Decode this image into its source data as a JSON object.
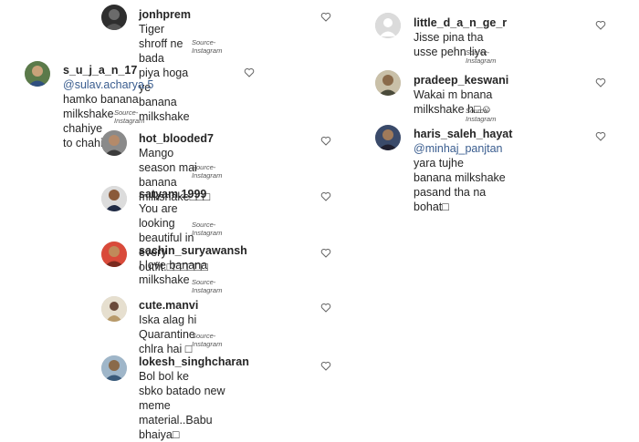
{
  "source_label": "Source-Instagram",
  "left_column": [
    {
      "username": "jonhprem",
      "mention": "",
      "line1": "Tiger shroff ne bada",
      "line2": "piya hoga ye banana milkshake"
    },
    {
      "username": "s_u_j_a_n_17",
      "mention": "@sulav.acharya.5",
      "line1": "hamko banana milkshake chahiye",
      "line2": "to chahiye□"
    },
    {
      "username": "hot_blooded7",
      "mention": "",
      "line1": "Mango season mai",
      "line2": "banana milkshake□□□"
    },
    {
      "username": "satyam.1999",
      "mention": "",
      "line1": "You are looking",
      "line2": "beautiful in every outfit.□□□□□□"
    },
    {
      "username": "sachin_suryawansh",
      "mention": "",
      "line1": "I love banana",
      "line2": "milkshake"
    },
    {
      "username": "cute.manvi",
      "mention": "",
      "line1": "Iska alag hi Quarantine",
      "line2": "chlra hai □"
    },
    {
      "username": "lokesh_singhcharan",
      "mention": "",
      "line1": "Bol bol ke",
      "line2": "sbko batado new meme",
      "line3": "material..Babu bhaiya□"
    }
  ],
  "right_column": [
    {
      "username": "little_d_a_n_ge_r",
      "line1": "Jisse pina tha",
      "line2": "usse pehn liya"
    },
    {
      "username": "pradeep_keswani",
      "line1": "Wakai m bnana",
      "line2": "milkshake h□☺"
    },
    {
      "username": "haris_saleh_hayat",
      "mention": "@minhaj_panjtan",
      "line1": "yara tujhe",
      "line2": "banana milkshake pasand tha na",
      "line3": "bohat□"
    }
  ],
  "colors": {
    "text": "#262626",
    "mention": "#3a5d8f",
    "source": "#555555"
  },
  "icons": {
    "like": "heart-outline-icon"
  }
}
